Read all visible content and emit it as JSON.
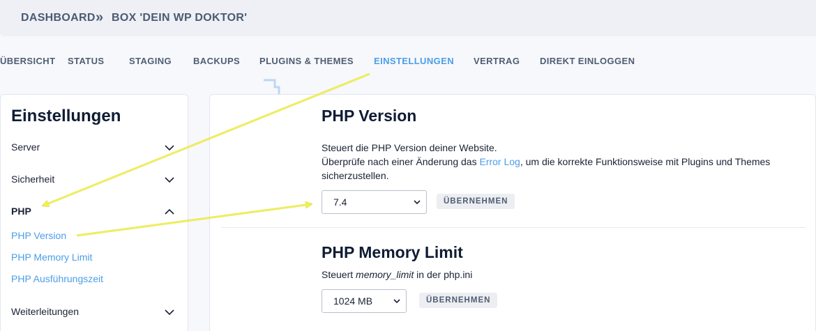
{
  "breadcrumb": {
    "root": "DASHBOARD",
    "separator": "»",
    "current": "BOX 'DEIN WP DOKTOR'"
  },
  "tabs": [
    {
      "label": "ÜBERSICHT",
      "active": false
    },
    {
      "label": "STATUS",
      "active": false
    },
    {
      "label": "STAGING",
      "active": false
    },
    {
      "label": "BACKUPS",
      "active": false
    },
    {
      "label": "PLUGINS & THEMES",
      "active": false
    },
    {
      "label": "EINSTELLUNGEN",
      "active": true
    },
    {
      "label": "VERTRAG",
      "active": false
    },
    {
      "label": "DIREKT EINLOGGEN",
      "active": false
    }
  ],
  "sidebar": {
    "title": "Einstellungen",
    "items": [
      {
        "label": "Server",
        "expanded": false,
        "icon": "chevron-down-icon"
      },
      {
        "label": "Sicherheit",
        "expanded": false,
        "icon": "chevron-down-icon"
      },
      {
        "label": "PHP",
        "expanded": true,
        "icon": "chevron-up-icon"
      },
      {
        "label": "Weiterleitungen",
        "expanded": false,
        "icon": "chevron-down-icon"
      }
    ],
    "php_sub": [
      "PHP Version",
      "PHP Memory Limit",
      "PHP Ausführungszeit"
    ]
  },
  "php_version": {
    "title": "PHP Version",
    "line1": "Steuert die PHP Version deiner Website.",
    "line2_pre": "Überprüfe nach einer Änderung das ",
    "line2_link": "Error Log",
    "line2_post": ", um die korrekte Funktionsweise mit Plugins und Themes",
    "line3": "sicherzustellen.",
    "select_value": "7.4",
    "button": "ÜBERNEHMEN"
  },
  "php_memory": {
    "title": "PHP Memory Limit",
    "desc_pre": "Steuert ",
    "desc_em": "memory_limit",
    "desc_post": " in der php.ini",
    "select_value": "1024 MB",
    "button": "ÜBERNEHMEN"
  },
  "colors": {
    "accent": "#4a9ee8",
    "annotation": "#f2f24a"
  }
}
